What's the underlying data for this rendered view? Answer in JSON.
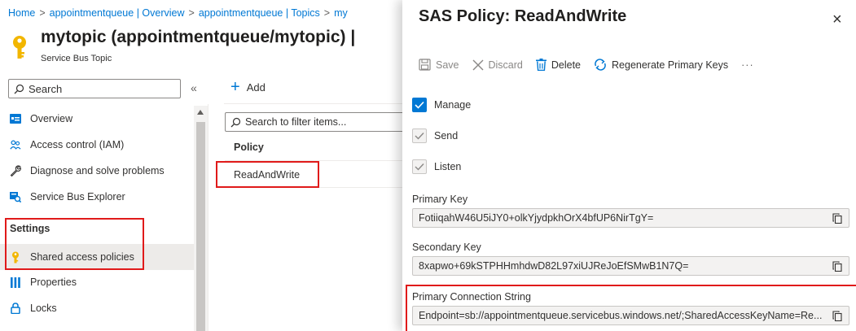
{
  "breadcrumb": {
    "home": "Home",
    "item1": "appointmentqueue | Overview",
    "item2": "appointmentqueue | Topics",
    "item3": "my",
    "separator": ">"
  },
  "header": {
    "title": "mytopic (appointmentqueue/mytopic) |",
    "subtitle": "Service Bus Topic"
  },
  "sidebar": {
    "search_placeholder": "Search",
    "collapse_glyph": "«",
    "items": [
      {
        "label": "Overview",
        "icon": "overview-icon"
      },
      {
        "label": "Access control (IAM)",
        "icon": "people-icon"
      },
      {
        "label": "Diagnose and solve problems",
        "icon": "wrench-icon"
      },
      {
        "label": "Service Bus Explorer",
        "icon": "explorer-icon"
      }
    ],
    "section_settings": "Settings",
    "settings_items": [
      {
        "label": "Shared access policies",
        "icon": "key-icon",
        "active": true
      },
      {
        "label": "Properties",
        "icon": "properties-icon"
      },
      {
        "label": "Locks",
        "icon": "lock-icon"
      }
    ]
  },
  "middle": {
    "add_label": "Add",
    "filter_placeholder": "Search to filter items...",
    "column_policy": "Policy",
    "rows": [
      {
        "policy": "ReadAndWrite"
      }
    ]
  },
  "panel": {
    "title": "SAS Policy: ReadAndWrite",
    "close_glyph": "×",
    "toolbar": {
      "save": "Save",
      "discard": "Discard",
      "delete": "Delete",
      "regenerate": "Regenerate Primary Keys",
      "more": "···"
    },
    "checkboxes": {
      "manage": {
        "label": "Manage",
        "checked": true
      },
      "send": {
        "label": "Send",
        "checked": true
      },
      "listen": {
        "label": "Listen",
        "checked": true
      }
    },
    "primary_key_label": "Primary Key",
    "primary_key_value": "FotiiqahW46U5iJY0+olkYjydpkhOrX4bfUP6NirTgY=",
    "secondary_key_label": "Secondary Key",
    "secondary_key_value": "8xapwo+69kSTPHHmhdwD82L97xiUJReJoEfSMwB1N7Q=",
    "primary_conn_label": "Primary Connection String",
    "primary_conn_value": "Endpoint=sb://appointmentqueue.servicebus.windows.net/;SharedAccessKeyName=Re..."
  },
  "colors": {
    "accent": "#0078d4",
    "highlight": "#e01a1a",
    "key_gold": "#f2b600"
  }
}
